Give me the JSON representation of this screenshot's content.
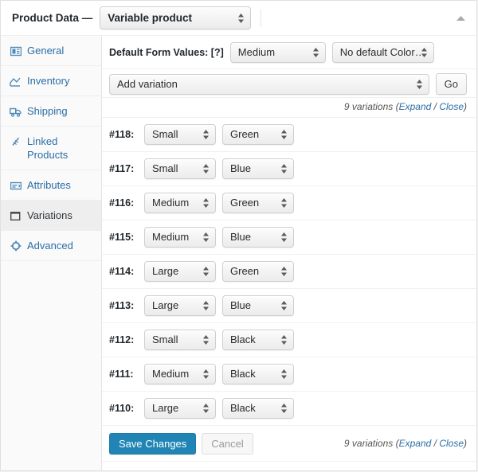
{
  "header": {
    "title": "Product Data —",
    "product_type": "Variable product",
    "collapse_icon": "triangle-up-icon"
  },
  "sidebar": {
    "items": [
      {
        "label": "General",
        "icon": "general-icon",
        "active": false
      },
      {
        "label": "Inventory",
        "icon": "inventory-icon",
        "active": false
      },
      {
        "label": "Shipping",
        "icon": "shipping-icon",
        "active": false
      },
      {
        "label": "Linked Products",
        "icon": "linked-icon",
        "active": false
      },
      {
        "label": "Attributes",
        "icon": "attributes-icon",
        "active": false
      },
      {
        "label": "Variations",
        "icon": "variations-icon",
        "active": true
      },
      {
        "label": "Advanced",
        "icon": "advanced-icon",
        "active": false
      }
    ]
  },
  "defaults": {
    "label": "Default Form Values: [?]",
    "size_value": "Medium",
    "color_value": "No default Color…"
  },
  "add_variation": {
    "select_value": "Add variation",
    "go_label": "Go"
  },
  "variation_count": {
    "text": "9 variations (",
    "expand_label": "Expand",
    "separator": " / ",
    "close_label": "Close",
    "suffix": ")"
  },
  "variations": [
    {
      "id": "#118:",
      "size": "Small",
      "color": "Green"
    },
    {
      "id": "#117:",
      "size": "Small",
      "color": "Blue"
    },
    {
      "id": "#116:",
      "size": "Medium",
      "color": "Green"
    },
    {
      "id": "#115:",
      "size": "Medium",
      "color": "Blue"
    },
    {
      "id": "#114:",
      "size": "Large",
      "color": "Green"
    },
    {
      "id": "#113:",
      "size": "Large",
      "color": "Blue"
    },
    {
      "id": "#112:",
      "size": "Small",
      "color": "Black"
    },
    {
      "id": "#111:",
      "size": "Medium",
      "color": "Black"
    },
    {
      "id": "#110:",
      "size": "Large",
      "color": "Black"
    }
  ],
  "footer": {
    "save_label": "Save Changes",
    "cancel_label": "Cancel"
  },
  "colors": {
    "accent_blue": "#2085b5",
    "link_blue": "#2b6ea5",
    "panel_bg": "#ffffff",
    "page_bg": "#f1f1f1",
    "sidebar_bg": "#fafafa",
    "active_bg": "#eeeeee"
  }
}
